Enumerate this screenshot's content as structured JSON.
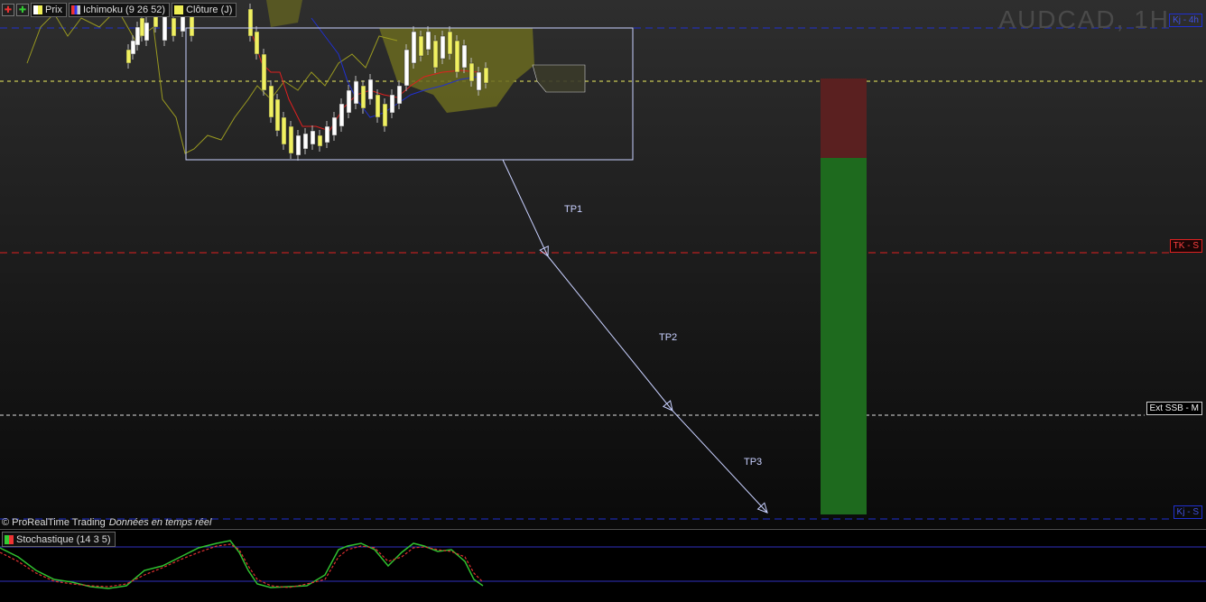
{
  "legend": {
    "prix": "Prix",
    "ichimoku": "Ichimoku (9 26 52)",
    "cloture": "Clôture (J)"
  },
  "watermark": "AUDCAD, 1H",
  "axis_tags": {
    "kj_4h": "Kj - 4h",
    "tk_s": "TK - S",
    "ext_ssb_m": "Ext SSB - M",
    "kj_s": "Kj - S"
  },
  "targets": {
    "tp1": "TP1",
    "tp2": "TP2",
    "tp3": "TP3"
  },
  "footer": {
    "credit": "© ProRealTime Trading",
    "realtime": "Données en temps réel"
  },
  "oscillator": {
    "title": "Stochastique (14 3 5)"
  },
  "colors": {
    "up_candle": "#ffffff",
    "down_candle": "#f0f060",
    "kijun_red": "#e02020",
    "kijun_blue": "#2030d0",
    "ext_white": "#dddddd",
    "cloud": "#6a6a20",
    "risk_zone": "#5a2020",
    "reward_zone": "#1e6a1e"
  }
}
